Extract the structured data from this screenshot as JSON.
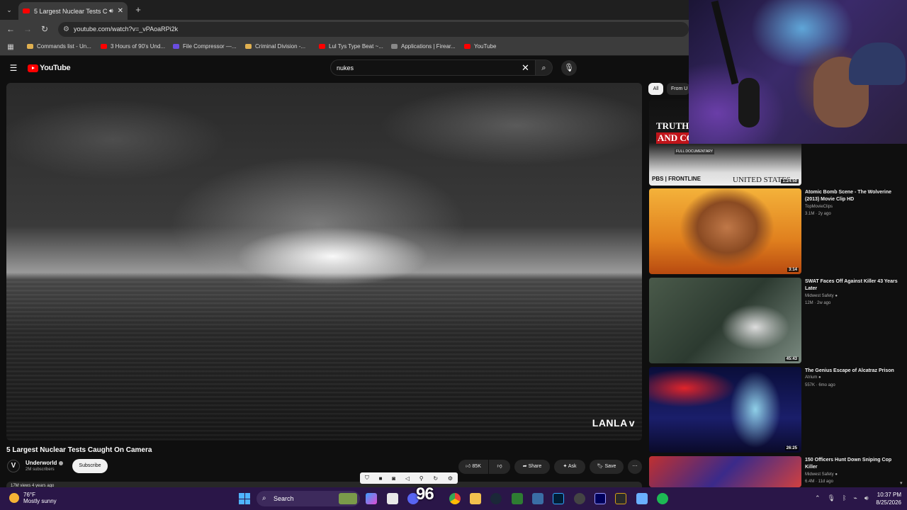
{
  "browser": {
    "tab_title": "5 Largest Nuclear Tests Cau",
    "url": "youtube.com/watch?v=_vPAoaRPi2k",
    "bookmarks": [
      {
        "label": "Commands list - Un...",
        "color": "#e0b050"
      },
      {
        "label": "3 Hours of 90's Und...",
        "color": "#ff0000"
      },
      {
        "label": "File Compressor —...",
        "color": "#6a4de0"
      },
      {
        "label": "Criminal Division -...",
        "color": "#e0b050"
      },
      {
        "label": "Lul Tys Type Beat ~...",
        "color": "#ff0000"
      },
      {
        "label": "Applications | Firear...",
        "color": "#888888"
      },
      {
        "label": "YouTube",
        "color": "#ff0000"
      }
    ]
  },
  "youtube": {
    "logo_text": "YouTube",
    "search_value": "nukes",
    "video": {
      "title": "5 Largest Nuclear Tests Caught On Camera",
      "watermark": "LANLA",
      "channel": "Underworld",
      "channel_initial": "V",
      "subscribers": "2M subscribers",
      "subscribe_label": "Subscribe",
      "likes": "85K",
      "share_label": "Share",
      "ask_label": "Ask",
      "save_label": "Save",
      "views_strip": "17M views 4 years ago"
    },
    "chips": [
      {
        "label": "All"
      },
      {
        "label": "From U"
      }
    ],
    "recommendations": [
      {
        "title": "",
        "channel": "",
        "meta": "",
        "duration": "1:24:50",
        "thumb_text_1": "TRUTH, W",
        "thumb_text_2": "AND CONS",
        "thumb_tag": "FULL DOCUMENTARY",
        "thumb_brand": "PBS | FRONTLINE",
        "thumb_text_3": "UNITED STATES"
      },
      {
        "title": "Atomic Bomb Scene - The Wolverine (2013) Movie Clip HD",
        "channel": "TopMovieClips",
        "meta": "3.1M · 2y ago",
        "duration": "3:14"
      },
      {
        "title": "SWAT Faces Off Against Killer 43 Years Later",
        "channel": "Midwest Safety",
        "meta": "12M · 2w ago",
        "duration": "45:43"
      },
      {
        "title": "The Genius Escape of Alcatraz Prison",
        "channel": "Atrium",
        "meta": "557K · 6mo ago",
        "duration": "26:25"
      },
      {
        "title": "150 Officers Hunt Down Sniping Cop Killer",
        "channel": "Midwest Safety",
        "meta": "6.4M · 11d ago",
        "duration": ""
      }
    ]
  },
  "taskbar": {
    "temp": "76°F",
    "weather": "Mostly sunny",
    "search_label": "Search",
    "overlay_number": "96",
    "time": "10:37 PM",
    "date": "8/25/2026"
  }
}
